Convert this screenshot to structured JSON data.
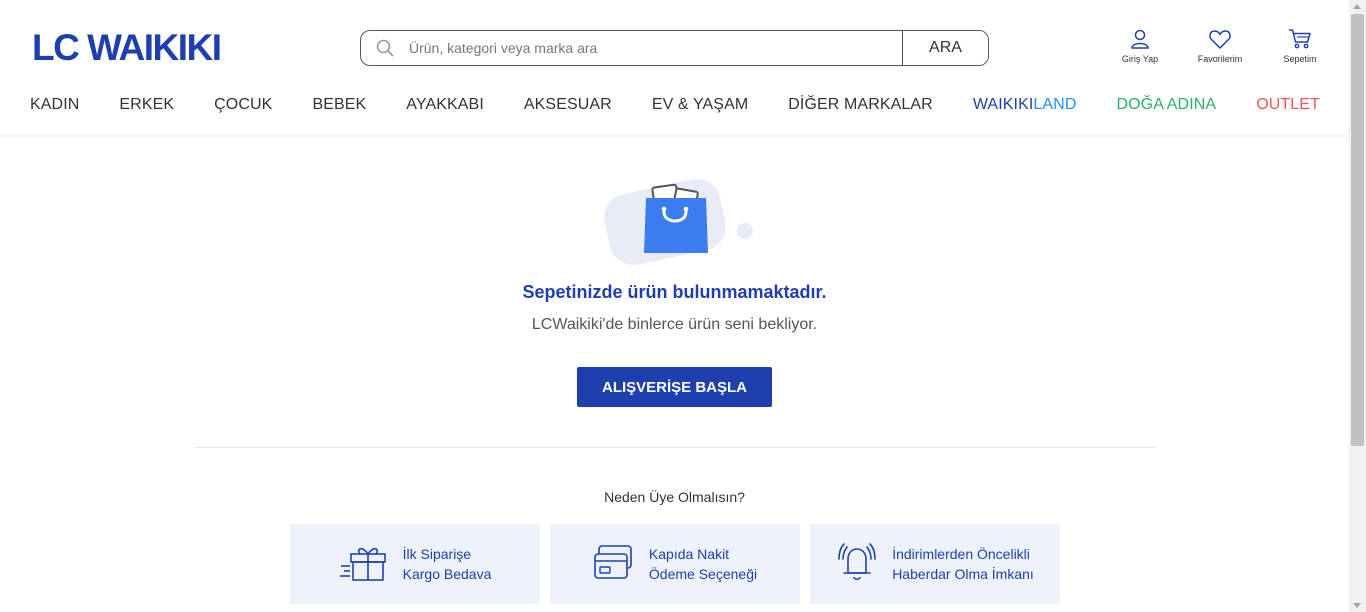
{
  "logo": "LC WAIKIKI",
  "search": {
    "placeholder": "Ürün, kategori veya marka ara",
    "button": "ARA"
  },
  "actions": [
    {
      "label": "Giriş Yap",
      "icon": "user-icon"
    },
    {
      "label": "Favorilerim",
      "icon": "heart-icon"
    },
    {
      "label": "Sepetim",
      "icon": "cart-icon"
    }
  ],
  "nav": {
    "kadin": "KADIN",
    "erkek": "ERKEK",
    "cocuk": "ÇOCUK",
    "bebek": "BEBEK",
    "ayakkabi": "AYAKKABI",
    "aksesuar": "AKSESUAR",
    "ev": "EV & YAŞAM",
    "diger": "DİĞER MARKALAR",
    "waikiki_part1": "WAIKIKI",
    "waikiki_part2": "LAND",
    "doga": "DOĞA ADINA",
    "outlet": "OUTLET"
  },
  "empty_cart": {
    "title": "Sepetinizde ürün bulunmamaktadır.",
    "subtitle": "LCWaikiki'de binlerce ürün seni bekliyor.",
    "button": "ALIŞVERİŞE BAŞLA"
  },
  "why": {
    "title": "Neden Üye Olmalısın?",
    "benefits": [
      {
        "line1": "İlk Siparişe",
        "line2": "Kargo Bedava",
        "icon": "gift-icon"
      },
      {
        "line1": "Kapıda Nakit",
        "line2": "Ödeme Seçeneği",
        "icon": "credit-card-icon"
      },
      {
        "line1": "İndirimlerden Öncelikli",
        "line2": "Haberdar Olma İmkanı",
        "icon": "bell-icon"
      }
    ]
  },
  "colors": {
    "brand": "#1e40af",
    "waikikiland": "#1e90ff",
    "doga": "#2ab068",
    "outlet": "#ee5555",
    "benefit_bg": "#eef2fb"
  }
}
